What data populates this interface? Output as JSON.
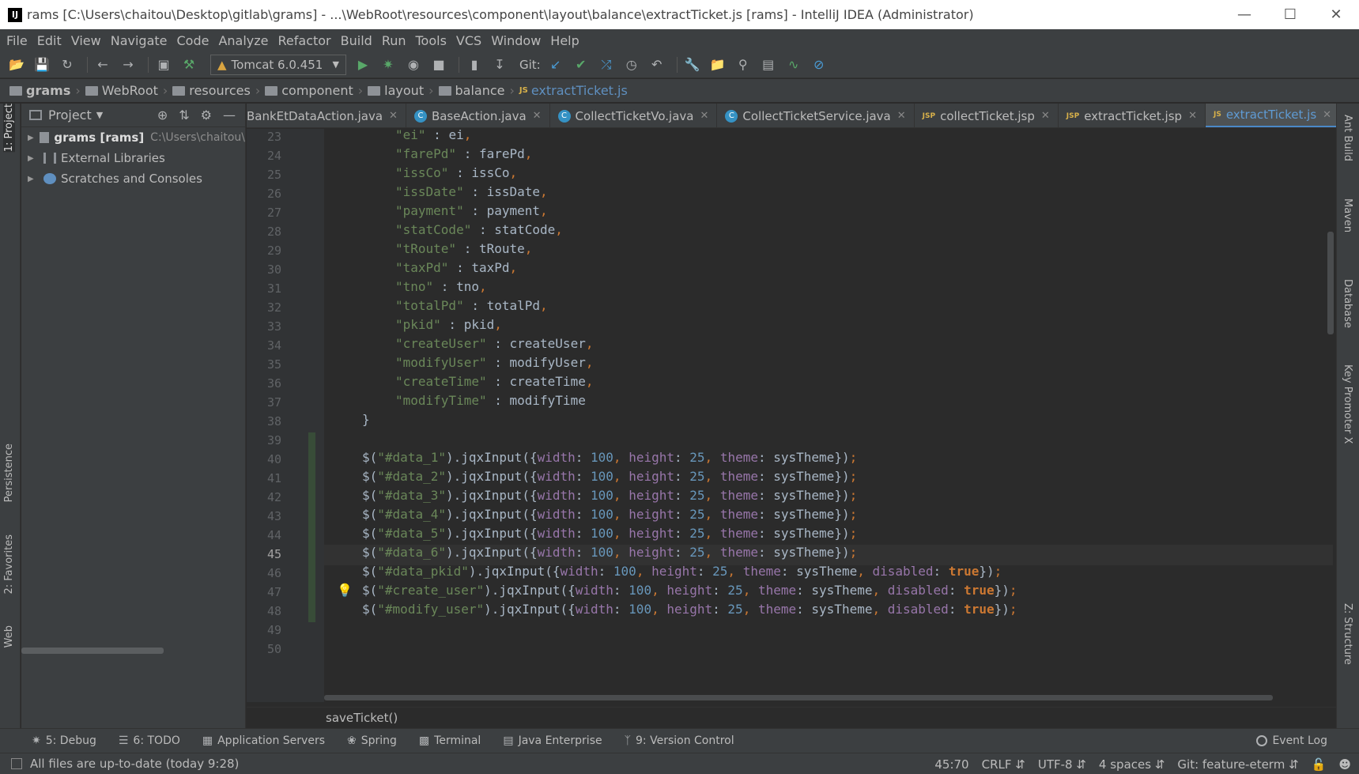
{
  "window": {
    "title": "rams [C:\\Users\\chaitou\\Desktop\\gitlab\\grams] - ...\\WebRoot\\resources\\component\\layout\\balance\\extractTicket.js [rams] - IntelliJ IDEA (Administrator)",
    "app_icon": "IJ"
  },
  "menu": [
    "File",
    "Edit",
    "View",
    "Navigate",
    "Code",
    "Analyze",
    "Refactor",
    "Build",
    "Run",
    "Tools",
    "VCS",
    "Window",
    "Help"
  ],
  "toolbar": {
    "run_config": "Tomcat 6.0.451",
    "git_label": "Git:"
  },
  "breadcrumb": [
    "grams",
    "WebRoot",
    "resources",
    "component",
    "layout",
    "balance",
    "extractTicket.js"
  ],
  "left_strip": {
    "project": "1: Project",
    "persistence": "Persistence",
    "favorites": "2: Favorites",
    "web": "Web"
  },
  "right_strip": {
    "ant": "Ant Build",
    "maven": "Maven",
    "database": "Database",
    "key_promoter": "Key Promoter X",
    "structure": "Z: Structure"
  },
  "project_panel": {
    "title": "Project",
    "items": [
      {
        "label": "grams [rams]",
        "path": "C:\\Users\\chaitou\\"
      },
      {
        "label": "External Libraries",
        "path": ""
      },
      {
        "label": "Scratches and Consoles",
        "path": ""
      }
    ]
  },
  "tabs": [
    {
      "label": "BankEtDataAction.java",
      "icon": "class"
    },
    {
      "label": "BaseAction.java",
      "icon": "class"
    },
    {
      "label": "CollectTicketVo.java",
      "icon": "class"
    },
    {
      "label": "CollectTicketService.java",
      "icon": "class"
    },
    {
      "label": "collectTicket.jsp",
      "icon": "jsp"
    },
    {
      "label": "extractTicket.jsp",
      "icon": "jsp"
    },
    {
      "label": "extractTicket.js",
      "icon": "jsp"
    }
  ],
  "tabs_overflow": "2",
  "code": {
    "current_line": 45,
    "lines": [
      {
        "n": 23,
        "text": "\"ei\" : ei,"
      },
      {
        "n": 24,
        "text": "\"farePd\" : farePd,"
      },
      {
        "n": 25,
        "text": "\"issCo\" : issCo,"
      },
      {
        "n": 26,
        "text": "\"issDate\" : issDate,"
      },
      {
        "n": 27,
        "text": "\"payment\" : payment,"
      },
      {
        "n": 28,
        "text": "\"statCode\" : statCode,"
      },
      {
        "n": 29,
        "text": "\"tRoute\" : tRoute,"
      },
      {
        "n": 30,
        "text": "\"taxPd\" : taxPd,"
      },
      {
        "n": 31,
        "text": "\"tno\" : tno,"
      },
      {
        "n": 32,
        "text": "\"totalPd\" : totalPd,"
      },
      {
        "n": 33,
        "text": "\"pkid\" : pkid,"
      },
      {
        "n": 34,
        "text": "\"createUser\" : createUser,"
      },
      {
        "n": 35,
        "text": "\"modifyUser\" : modifyUser,"
      },
      {
        "n": 36,
        "text": "\"createTime\" : createTime,"
      },
      {
        "n": 37,
        "text": "\"modifyTime\" : modifyTime"
      },
      {
        "n": 38,
        "text": "}"
      },
      {
        "n": 39,
        "text": ""
      },
      {
        "n": 40,
        "text": "$(\"#data_1\").jqxInput({width: 100, height: 25, theme: sysTheme});"
      },
      {
        "n": 41,
        "text": "$(\"#data_2\").jqxInput({width: 100, height: 25, theme: sysTheme});"
      },
      {
        "n": 42,
        "text": "$(\"#data_3\").jqxInput({width: 100, height: 25, theme: sysTheme});"
      },
      {
        "n": 43,
        "text": "$(\"#data_4\").jqxInput({width: 100, height: 25, theme: sysTheme});"
      },
      {
        "n": 44,
        "text": "$(\"#data_5\").jqxInput({width: 100, height: 25, theme: sysTheme});"
      },
      {
        "n": 45,
        "text": "$(\"#data_6\").jqxInput({width: 100, height: 25, theme: sysTheme});"
      },
      {
        "n": 46,
        "text": "$(\"#data_pkid\").jqxInput({width: 100, height: 25, theme: sysTheme, disabled: true});"
      },
      {
        "n": 47,
        "text": "$(\"#create_user\").jqxInput({width: 100, height: 25, theme: sysTheme, disabled: true});"
      },
      {
        "n": 48,
        "text": "$(\"#modify_user\").jqxInput({width: 100, height: 25, theme: sysTheme, disabled: true});"
      },
      {
        "n": 49,
        "text": ""
      },
      {
        "n": 50,
        "text": ""
      }
    ]
  },
  "method_breadcrumb": "saveTicket()",
  "tool_windows": [
    {
      "label": "5: Debug",
      "icon": "bug-icon"
    },
    {
      "label": "6: TODO",
      "icon": "list-icon"
    },
    {
      "label": "Application Servers",
      "icon": "server-icon"
    },
    {
      "label": "Spring",
      "icon": "leaf-icon"
    },
    {
      "label": "Terminal",
      "icon": "terminal-icon"
    },
    {
      "label": "Java Enterprise",
      "icon": "java-icon"
    },
    {
      "label": "9: Version Control",
      "icon": "vcs-icon"
    }
  ],
  "event_log": "Event Log",
  "status": {
    "message": "All files are up-to-date (today 9:28)",
    "position": "45:70",
    "line_sep": "CRLF",
    "encoding": "UTF-8",
    "indent": "4 spaces",
    "git_branch": "Git: feature-eterm"
  }
}
